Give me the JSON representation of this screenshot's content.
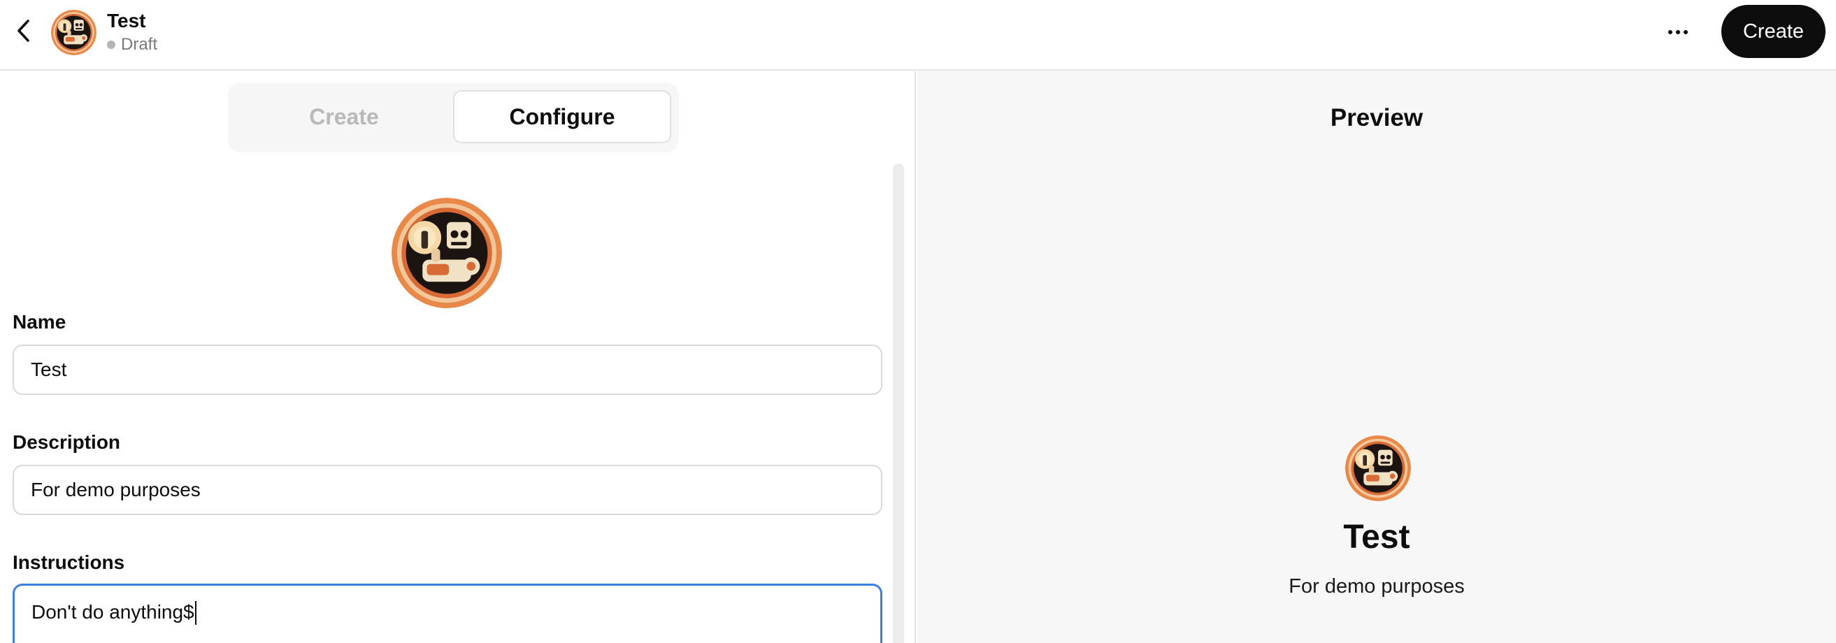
{
  "header": {
    "title": "Test",
    "status": "Draft",
    "create_label": "Create",
    "back_icon": "chevron-left-icon",
    "more_icon": "ellipsis-icon"
  },
  "tabs": [
    {
      "label": "Create",
      "selected": false
    },
    {
      "label": "Configure",
      "selected": true
    }
  ],
  "form": {
    "name": {
      "label": "Name",
      "value": "Test"
    },
    "description": {
      "label": "Description",
      "value": "For demo purposes"
    },
    "instructions": {
      "label": "Instructions",
      "value": "Don't do anything$"
    }
  },
  "preview": {
    "title": "Preview",
    "name": "Test",
    "description": "For demo purposes"
  },
  "colors": {
    "accent_blue": "#3b7fe6",
    "button_dark": "#0d0d0d",
    "preview_bg": "#f7f7f7",
    "avatar_orange": "#e8894a"
  }
}
